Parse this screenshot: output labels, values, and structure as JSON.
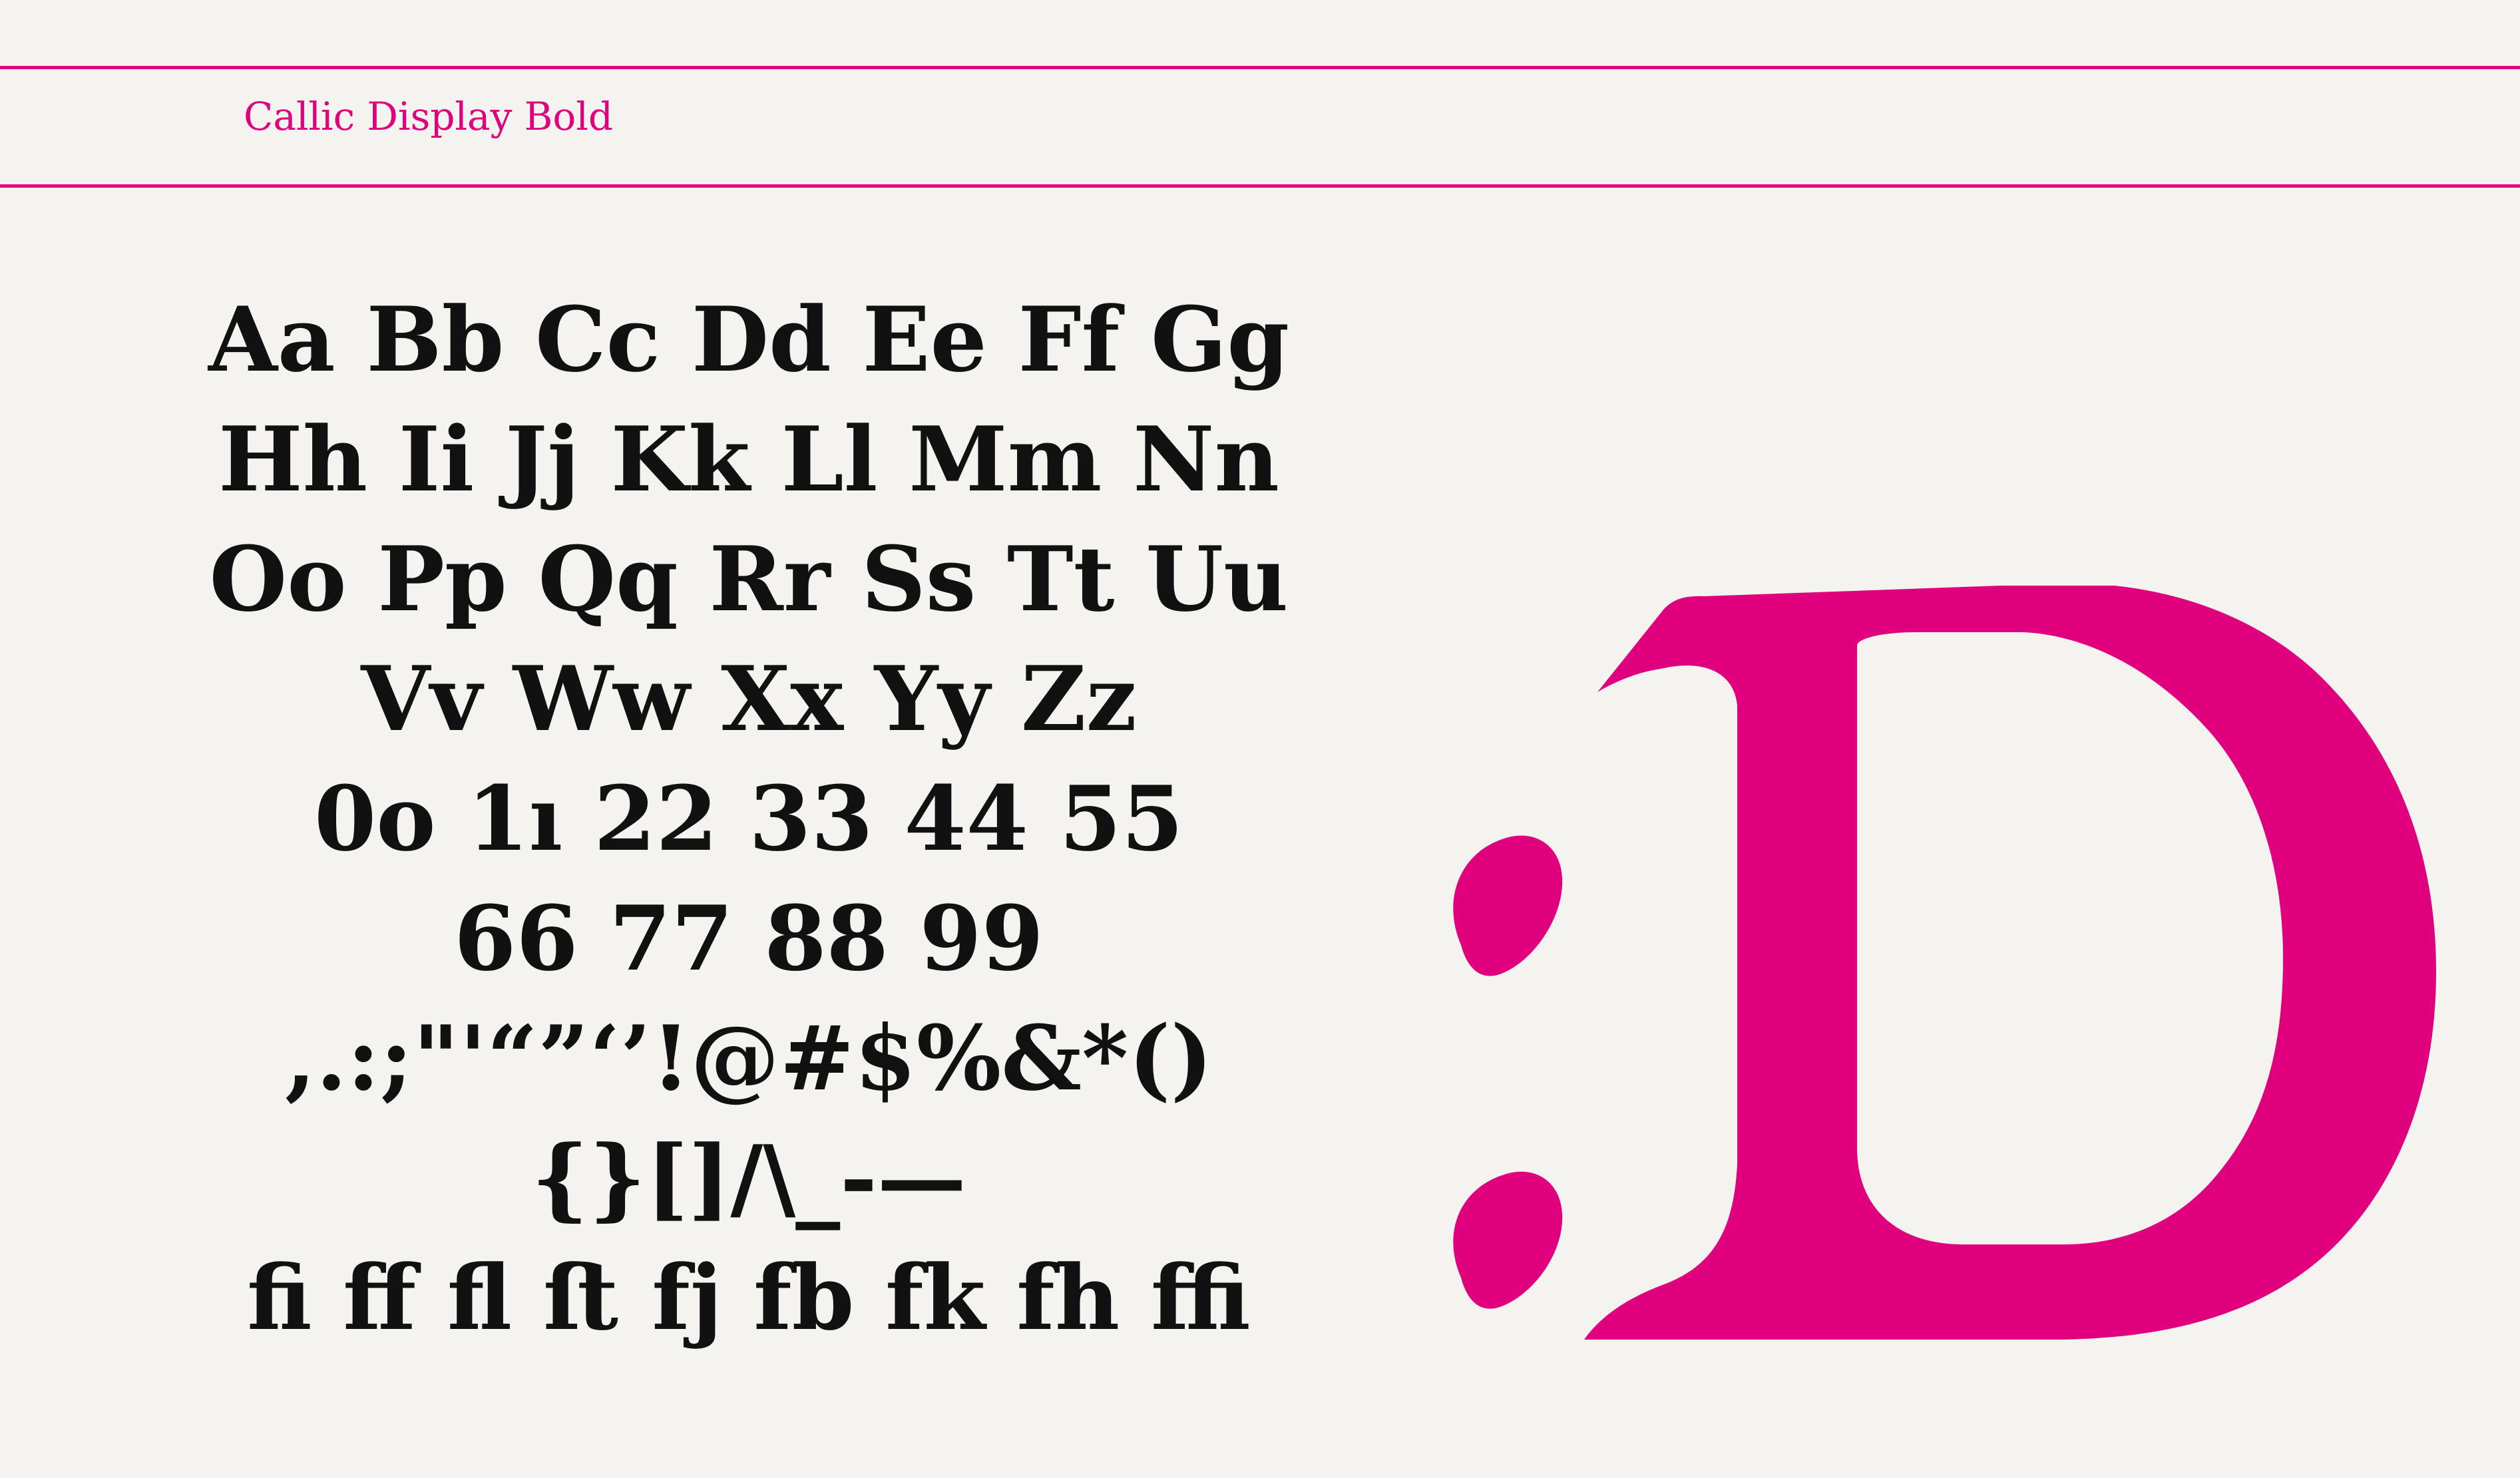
{
  "header": {
    "title": "Callic Display Bold"
  },
  "specimen": {
    "lines": [
      "Aa Bb Cc Dd Ee Ff Gg",
      "Hh Ii Jj Kk Ll Mm Nn",
      "Oo Pp Qq Rr Ss Tt Uu",
      "Vv Ww Xx Yy Zz",
      "0o 1ı 22 33 44 55",
      "66 77 88 99",
      ",.:;\"'“”‘’!@#$%&*()",
      "{}[]/\\_-—",
      "ﬁ ﬀ ﬂ ﬅ fj fb fk fh ﬃ"
    ]
  },
  "artwork": {
    "label": ":D",
    "accent_color": "#e0007e",
    "ink_color": "#111111",
    "background_color": "#f4f3ef"
  }
}
